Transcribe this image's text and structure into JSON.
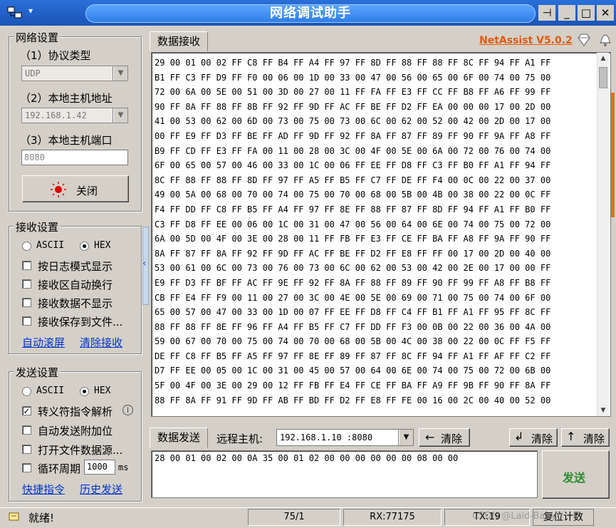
{
  "window": {
    "title": "网络调试助手",
    "sys_menu_glyph": "▾",
    "pin_glyph": "⊣",
    "min_glyph": "_",
    "max_glyph": "□",
    "close_glyph": "✕"
  },
  "network": {
    "group_label": "网络设置",
    "protocol_label": "（1）协议类型",
    "protocol_value": "UDP",
    "local_host_label": "（2）本地主机地址",
    "local_host_value": "192.168.1.42",
    "local_port_label": "（3）本地主机端口",
    "local_port_value": "8080",
    "close_button": "关闭"
  },
  "receive_settings": {
    "group_label": "接收设置",
    "ascii_label": "ASCII",
    "hex_label": "HEX",
    "options": [
      {
        "label": "按日志模式显示",
        "checked": false
      },
      {
        "label": "接收区自动换行",
        "checked": false
      },
      {
        "label": "接收数据不显示",
        "checked": false
      },
      {
        "label": "接收保存到文件...",
        "checked": false
      }
    ],
    "auto_scroll_link": "自动滚屏",
    "clear_link": "清除接收"
  },
  "send_settings": {
    "group_label": "发送设置",
    "ascii_label": "ASCII",
    "hex_label": "HEX",
    "options": [
      {
        "label": "转义符指令解析",
        "checked": true
      },
      {
        "label": "自动发送附加位",
        "checked": false
      },
      {
        "label": "打开文件数据源...",
        "checked": false
      },
      {
        "label": "循环周期",
        "checked": false
      }
    ],
    "cycle_value": "1000",
    "cycle_unit": "ms",
    "shortcut_link": "快捷指令",
    "history_link": "历史发送"
  },
  "receive_area": {
    "tab_label": "数据接收",
    "version": "NetAssist V5.0.2",
    "lines": [
      "29 00 01 00 02 FF C8 FF B4 FF A4 FF 97 FF 8D FF 88 FF 88 FF 8C FF 94 FF A1 FF",
      "B1 FF C3 FF D9 FF F0 00 06 00 1D 00 33 00 47 00 56 00 65 00 6F 00 74 00 75 00",
      "72 00 6A 00 5E 00 51 00 3D 00 27 00 11 FF FA FF E3 FF CC FF B8 FF A6 FF 99 FF",
      "90 FF 8A FF 88 FF 8B FF 92 FF 9D FF AC FF BE FF D2 FF EA 00 00 00 17 00 2D 00",
      "41 00 53 00 62 00 6D 00 73 00 75 00 73 00 6C 00 62 00 52 00 42 00 2D 00 17 00",
      "00 FF E9 FF D3 FF BE FF AD FF 9D FF 92 FF 8A FF 87 FF 89 FF 90 FF 9A FF A8 FF",
      "B9 FF CD FF E3 FF FA 00 11 00 28 00 3C 00 4F 00 5E 00 6A 00 72 00 76 00 74 00",
      "6F 00 65 00 57 00 46 00 33 00 1C 00 06 FF EE FF D8 FF C3 FF B0 FF A1 FF 94 FF",
      "8C FF 88 FF 88 FF 8D FF 97 FF A5 FF B5 FF C7 FF DE FF F4 00 0C 00 22 00 37 00",
      "49 00 5A 00 68 00 70 00 74 00 75 00 70 00 68 00 5B 00 4B 00 38 00 22 00 0C FF",
      "F4 FF DD FF C8 FF B5 FF A4 FF 97 FF 8E FF 88 FF 87 FF 8D FF 94 FF A1 FF B0 FF",
      "C3 FF D8 FF EE 00 06 00 1C 00 31 00 47 00 56 00 64 00 6E 00 74 00 75 00 72 00",
      "6A 00 5D 00 4F 00 3E 00 28 00 11 FF FB FF E3 FF CE FF BA FF A8 FF 9A FF 90 FF",
      "8A FF 87 FF 8A FF 92 FF 9D FF AC FF BE FF D2 FF E8 FF FF 00 17 00 2D 00 40 00",
      "53 00 61 00 6C 00 73 00 76 00 73 00 6C 00 62 00 53 00 42 00 2E 00 17 00 00 FF",
      "E9 FF D3 FF BF FF AC FF 9E FF 92 FF 8A FF 88 FF 89 FF 90 FF 99 FF A8 FF B8 FF",
      "CB FF E4 FF F9 00 11 00 27 00 3C 00 4E 00 5E 00 69 00 71 00 75 00 74 00 6F 00",
      "65 00 57 00 47 00 33 00 1D 00 07 FF EE FF D8 FF C4 FF B1 FF A1 FF 95 FF 8C FF",
      "88 FF 88 FF 8E FF 96 FF A4 FF B5 FF C7 FF DD FF F3 00 0B 00 22 00 36 00 4A 00",
      "59 00 67 00 70 00 75 00 74 00 70 00 68 00 5B 00 4C 00 38 00 22 00 0C FF F5 FF",
      "DE FF C8 FF B5 FF A5 FF 97 FF 8E FF 89 FF 87 FF 8C FF 94 FF A1 FF AF FF C2 FF",
      "D7 FF EE 00 05 00 1C 00 31 00 45 00 57 00 64 00 6E 00 74 00 75 00 72 00 6B 00",
      "5F 00 4F 00 3E 00 29 00 12 FF FB FF E4 FF CE FF BA FF A9 FF 9B FF 90 FF 8A FF",
      "88 FF 8A FF 91 FF 9D FF AB FF BD FF D2 FF E8 FF FE 00 16 00 2C 00 40 00 52 00"
    ]
  },
  "send_area": {
    "tab_label": "数据发送",
    "remote_host_label": "远程主机:",
    "remote_host_value": "192.168.1.10 :8080",
    "clear_button": "清除",
    "clear_button2": "清除",
    "clear_button3": "清除",
    "send_text": "28 00 01 00 02 00 0A 35 00 01 02 00 00 00 00 00 00 08 00 00",
    "send_button": "发送"
  },
  "status_bar": {
    "status": "就绪!",
    "counter": "75/1",
    "rx": "RX:77175",
    "tx": "TX:19",
    "reset": "复位计数",
    "watermark": "CSDN @Laid-Baby"
  },
  "colors": {
    "title_bar": "#1b55b8",
    "version_text": "#e05a10",
    "link": "#0033cc",
    "send_button_text": "#2e8b2e",
    "close_button_dot": "#e00000"
  }
}
